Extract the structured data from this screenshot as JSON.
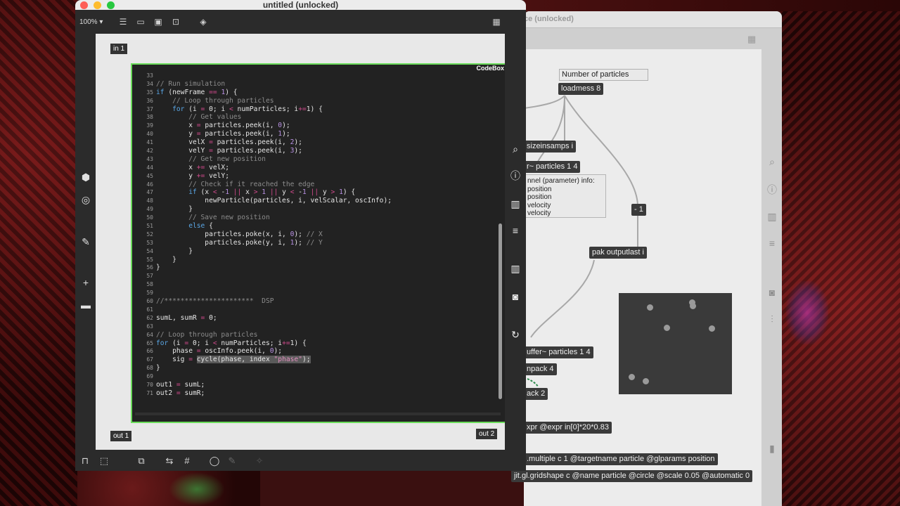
{
  "main_window": {
    "title": "untitled (unlocked)",
    "zoom": "100%",
    "inlet_label": "in 1",
    "outlet1_label": "out 1",
    "outlet2_label": "out 2",
    "codebox_label": "CodeBox"
  },
  "back_window": {
    "title": "ce (unlocked)",
    "objects": {
      "number_comment": "Number of particles",
      "loadmess": "loadmess 8",
      "sizeinsamps": "sizeinsamps i",
      "buffer_particles": "r~ particles 1 4",
      "channel_info": [
        "nnel (parameter) info:",
        "position",
        "position",
        "velocity",
        "velocity"
      ],
      "minus1": "- 1",
      "pak": "pak outputlast i",
      "buffer2": "uffer~ particles 1 4",
      "unpack": "npack 4",
      "pack2": "ack 2",
      "expr": "xpr @expr in[0]*20*0.83",
      "multiple": ".multiple c 1 @targetname particle @glparams position",
      "gridshape": "jit.gl.gridshape c @name particle @circle @scale 0.05 @automatic 0"
    }
  },
  "code_lines": [
    {
      "n": "33",
      "t": ""
    },
    {
      "n": "34",
      "t": "// Run simulation"
    },
    {
      "n": "35",
      "t": "if (newFrame == 1) {"
    },
    {
      "n": "36",
      "t": "    // Loop through particles"
    },
    {
      "n": "37",
      "t": "    for (i = 0; i < numParticles; i+=1) {"
    },
    {
      "n": "38",
      "t": "        // Get values"
    },
    {
      "n": "39",
      "t": "        x = particles.peek(i, 0);"
    },
    {
      "n": "40",
      "t": "        y = particles.peek(i, 1);"
    },
    {
      "n": "41",
      "t": "        velX = particles.peek(i, 2);"
    },
    {
      "n": "42",
      "t": "        velY = particles.peek(i, 3);"
    },
    {
      "n": "43",
      "t": "        // Get new position"
    },
    {
      "n": "44",
      "t": "        x += velX;"
    },
    {
      "n": "45",
      "t": "        y += velY;"
    },
    {
      "n": "46",
      "t": "        // Check if it reached the edge"
    },
    {
      "n": "47",
      "t": "        if (x < -1 || x > 1 || y < -1 || y > 1) {"
    },
    {
      "n": "48",
      "t": "            newParticle(particles, i, velScalar, oscInfo);"
    },
    {
      "n": "49",
      "t": "        }"
    },
    {
      "n": "50",
      "t": "        // Save new position"
    },
    {
      "n": "51",
      "t": "        else {"
    },
    {
      "n": "52",
      "t": "            particles.poke(x, i, 0); // X"
    },
    {
      "n": "53",
      "t": "            particles.poke(y, i, 1); // Y"
    },
    {
      "n": "54",
      "t": "        }"
    },
    {
      "n": "55",
      "t": "    }"
    },
    {
      "n": "56",
      "t": "}"
    },
    {
      "n": "57",
      "t": ""
    },
    {
      "n": "58",
      "t": ""
    },
    {
      "n": "59",
      "t": ""
    },
    {
      "n": "60",
      "t": "//**********************  DSP"
    },
    {
      "n": "61",
      "t": ""
    },
    {
      "n": "62",
      "t": "sumL, sumR = 0;"
    },
    {
      "n": "63",
      "t": ""
    },
    {
      "n": "64",
      "t": "// Loop through particles"
    },
    {
      "n": "65",
      "t": "for (i = 0; i < numParticles; i+=1) {"
    },
    {
      "n": "66",
      "t": "    phase = oscInfo.peek(i, 0);"
    },
    {
      "n": "67",
      "t": "    sig = cycle(phase, index \"phase\");"
    },
    {
      "n": "68",
      "t": "}"
    },
    {
      "n": "69",
      "t": ""
    },
    {
      "n": "70",
      "t": "out1 = sumL;"
    },
    {
      "n": "71",
      "t": "out2 = sumR;"
    }
  ],
  "colors": {
    "codebox_border": "#6adc5a",
    "keyword": "#5aa7e6",
    "operator": "#d14a8c",
    "number": "#b891e3",
    "comment": "#8c8c8c"
  },
  "icons": {
    "left_toolbar": [
      "cube-icon",
      "target-icon",
      "paperclip-icon",
      "plus-icon",
      "console-icon"
    ],
    "right_toolbar": [
      "search-icon",
      "info-icon",
      "book-icon",
      "list-icon",
      "book-icon",
      "camera-icon",
      "refresh-icon"
    ]
  }
}
